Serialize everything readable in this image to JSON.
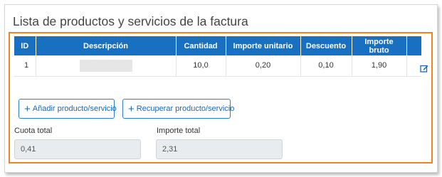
{
  "panel": {
    "title": "Lista de productos y servicios de la factura"
  },
  "table": {
    "headers": [
      "ID",
      "Descripción",
      "Cantidad",
      "Importe unitario",
      "Descuento",
      "Importe bruto"
    ],
    "rows": [
      {
        "id": "1",
        "descripcion": "",
        "cantidad": "10,0",
        "importe_unitario": "0,20",
        "descuento": "0,10",
        "importe_bruto": "1,90"
      }
    ]
  },
  "actions": {
    "add_label": "Añadir producto/servicio",
    "recover_label": "Recuperar producto/servicio"
  },
  "totals": {
    "cuota_label": "Cuota total",
    "cuota_value": "0,41",
    "importe_label": "Importe total",
    "importe_value": "2,31"
  },
  "colors": {
    "header_bg": "#1a70c0",
    "highlight_border": "#f58220",
    "button_border": "#2a7fc8"
  },
  "icons": {
    "edit": "edit-icon",
    "plus": "plus-icon"
  }
}
